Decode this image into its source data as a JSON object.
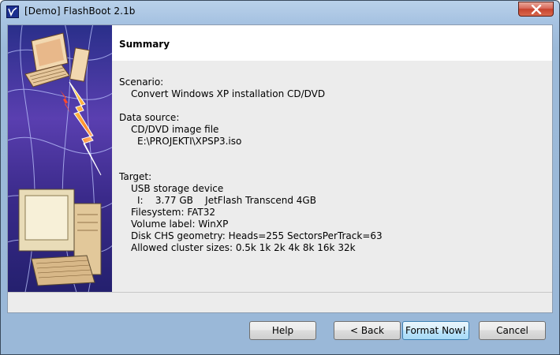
{
  "window": {
    "title": "[Demo] FlashBoot 2.1b",
    "icon": "flashboot-app-icon",
    "close_icon": "close-icon"
  },
  "header": {
    "title": "Summary"
  },
  "summary": {
    "scenario_heading": "Scenario:",
    "scenario_value": "Convert Windows XP installation CD/DVD",
    "source_heading": "Data source:",
    "source_type": "CD/DVD image file",
    "source_path": "E:\\PROJEKTI\\XPSP3.iso",
    "target_heading": "Target:",
    "target_type": "USB storage device",
    "target_drive": "I:    3.77 GB    JetFlash Transcend 4GB",
    "filesystem": "Filesystem: FAT32",
    "volume_label": "Volume label: WinXP",
    "geometry": "Disk CHS geometry: Heads=255 SectorsPerTrack=63",
    "cluster_sizes": "Allowed cluster sizes: 0.5k 1k 2k 4k 8k 16k 32k"
  },
  "buttons": {
    "help": "Help",
    "back": "< Back",
    "format": "Format Now!",
    "cancel": "Cancel"
  },
  "colors": {
    "header_bg": "#ffffff",
    "panel_bg": "#ececec",
    "side_art_bg": "#4a2f9a",
    "default_button_border": "#3c7fb1"
  }
}
